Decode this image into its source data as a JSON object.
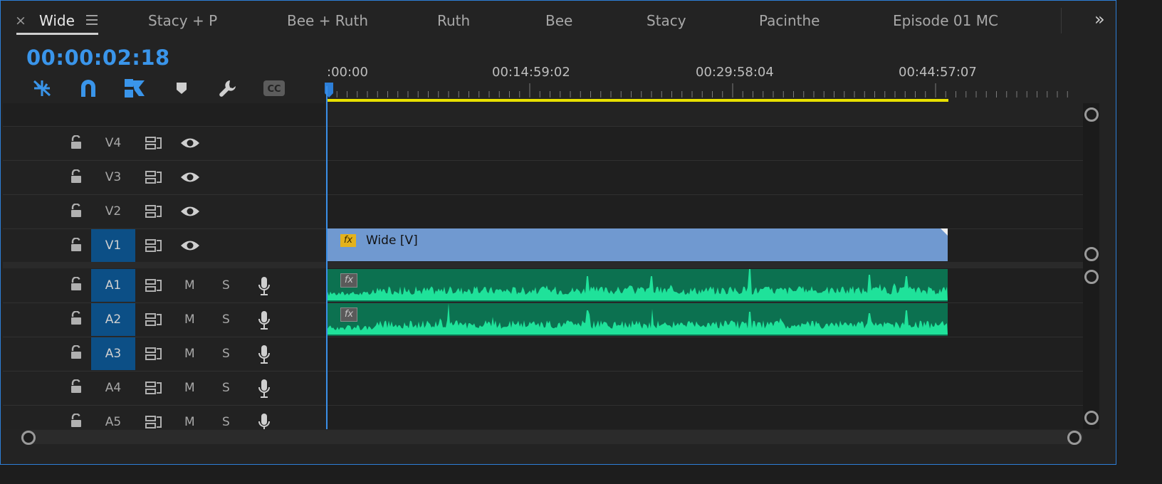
{
  "tabs": [
    {
      "label": "Wide",
      "active": true
    },
    {
      "label": "Stacy + P"
    },
    {
      "label": "Bee + Ruth"
    },
    {
      "label": "Ruth"
    },
    {
      "label": "Bee"
    },
    {
      "label": "Stacy"
    },
    {
      "label": "Pacinthe"
    },
    {
      "label": "Episode 01 MC"
    }
  ],
  "tab_close_glyph": "×",
  "overflow_glyph": "»",
  "timecode": "00:00:02:18",
  "toolbar": [
    "nest-toggle-icon",
    "snap-magnet-icon",
    "linked-selection-icon",
    "add-marker-icon",
    "settings-wrench-icon",
    "captions-icon"
  ],
  "captions_label": "CC",
  "ruler_labels": [
    ":00:00",
    "00:14:59:02",
    "00:29:58:04",
    "00:44:57:07"
  ],
  "video_tracks": [
    {
      "name": "V4",
      "targeted": false
    },
    {
      "name": "V3",
      "targeted": false
    },
    {
      "name": "V2",
      "targeted": false
    },
    {
      "name": "V1",
      "targeted": true
    }
  ],
  "audio_tracks": [
    {
      "name": "A1",
      "targeted": true
    },
    {
      "name": "A2",
      "targeted": true
    },
    {
      "name": "A3",
      "targeted": true
    },
    {
      "name": "A4",
      "targeted": false
    },
    {
      "name": "A5",
      "targeted": false
    }
  ],
  "mute_label": "M",
  "solo_label": "S",
  "clips": {
    "video": {
      "track": "V1",
      "name": "Wide [V]",
      "fx": "fx"
    },
    "audio": [
      {
        "track": "A1",
        "fx": "fx"
      },
      {
        "track": "A2",
        "fx": "fx"
      }
    ]
  },
  "colors": {
    "accent": "#3a95ea",
    "video_clip": "#7099d0",
    "audio_clip": "#0c7150",
    "waveform": "#1fe29a",
    "work_area": "#e8e000",
    "track_target": "#0c4f86"
  }
}
